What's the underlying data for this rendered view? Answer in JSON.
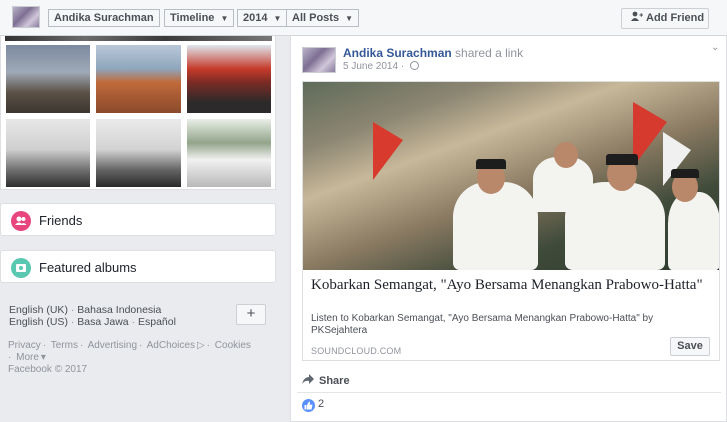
{
  "header": {
    "profile_name": "Andika Surachman",
    "timeline_label": "Timeline",
    "year_label": "2014",
    "filter_label": "All Posts",
    "add_friend_label": "Add Friend"
  },
  "left": {
    "friends_label": "Friends",
    "albums_label": "Featured albums",
    "languages": [
      "English (UK)",
      "Bahasa Indonesia",
      "English (US)",
      "Basa Jawa",
      "Español"
    ],
    "plus_label": "+",
    "footer_links": [
      "Privacy",
      "Terms",
      "Advertising",
      "AdChoices",
      "Cookies",
      "More"
    ],
    "copyright": "Facebook © 2017"
  },
  "post": {
    "author": "Andika Surachman",
    "action": "shared a link",
    "date": "5 June 2014",
    "link_title": "Kobarkan Semangat, \"Ayo Bersama Menangkan Prabowo-Hatta\"",
    "link_description": "Listen to Kobarkan Semangat, \"Ayo Bersama Menangkan Prabowo-Hatta\" by PKSejahtera",
    "link_domain": "SOUNDCLOUD.COM",
    "save_label": "Save",
    "share_label": "Share",
    "like_count": "2"
  },
  "icons": {
    "add_friend": "person-plus-icon",
    "globe": "globe-icon",
    "share": "share-arrow-icon",
    "like": "thumbs-up-icon",
    "friends": "friends-icon",
    "albums": "albums-icon"
  },
  "colors": {
    "link_blue": "#365899",
    "friends_icon": "#e8457e",
    "albums_icon": "#5ac8b0",
    "like_blue": "#5890ff"
  }
}
